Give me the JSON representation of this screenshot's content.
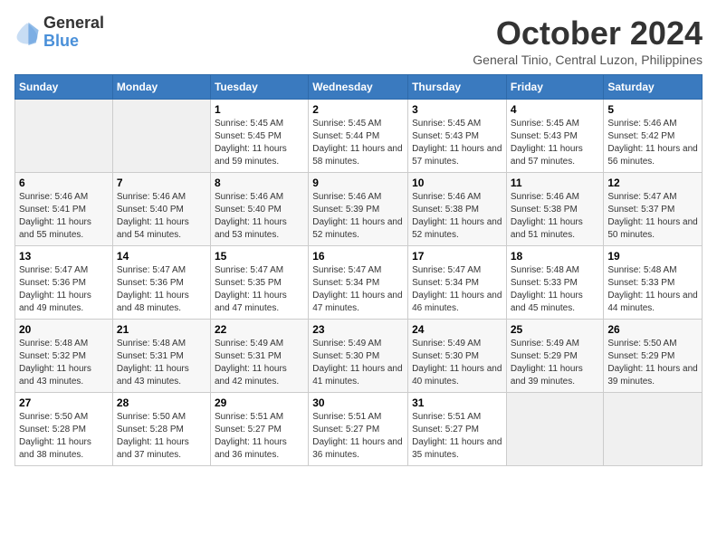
{
  "logo": {
    "general": "General",
    "blue": "Blue"
  },
  "title": "October 2024",
  "location": "General Tinio, Central Luzon, Philippines",
  "days_of_week": [
    "Sunday",
    "Monday",
    "Tuesday",
    "Wednesday",
    "Thursday",
    "Friday",
    "Saturday"
  ],
  "weeks": [
    [
      {
        "day": "",
        "content": ""
      },
      {
        "day": "",
        "content": ""
      },
      {
        "day": "1",
        "content": "Sunrise: 5:45 AM\nSunset: 5:45 PM\nDaylight: 11 hours and 59 minutes."
      },
      {
        "day": "2",
        "content": "Sunrise: 5:45 AM\nSunset: 5:44 PM\nDaylight: 11 hours and 58 minutes."
      },
      {
        "day": "3",
        "content": "Sunrise: 5:45 AM\nSunset: 5:43 PM\nDaylight: 11 hours and 57 minutes."
      },
      {
        "day": "4",
        "content": "Sunrise: 5:45 AM\nSunset: 5:43 PM\nDaylight: 11 hours and 57 minutes."
      },
      {
        "day": "5",
        "content": "Sunrise: 5:46 AM\nSunset: 5:42 PM\nDaylight: 11 hours and 56 minutes."
      }
    ],
    [
      {
        "day": "6",
        "content": "Sunrise: 5:46 AM\nSunset: 5:41 PM\nDaylight: 11 hours and 55 minutes."
      },
      {
        "day": "7",
        "content": "Sunrise: 5:46 AM\nSunset: 5:40 PM\nDaylight: 11 hours and 54 minutes."
      },
      {
        "day": "8",
        "content": "Sunrise: 5:46 AM\nSunset: 5:40 PM\nDaylight: 11 hours and 53 minutes."
      },
      {
        "day": "9",
        "content": "Sunrise: 5:46 AM\nSunset: 5:39 PM\nDaylight: 11 hours and 52 minutes."
      },
      {
        "day": "10",
        "content": "Sunrise: 5:46 AM\nSunset: 5:38 PM\nDaylight: 11 hours and 52 minutes."
      },
      {
        "day": "11",
        "content": "Sunrise: 5:46 AM\nSunset: 5:38 PM\nDaylight: 11 hours and 51 minutes."
      },
      {
        "day": "12",
        "content": "Sunrise: 5:47 AM\nSunset: 5:37 PM\nDaylight: 11 hours and 50 minutes."
      }
    ],
    [
      {
        "day": "13",
        "content": "Sunrise: 5:47 AM\nSunset: 5:36 PM\nDaylight: 11 hours and 49 minutes."
      },
      {
        "day": "14",
        "content": "Sunrise: 5:47 AM\nSunset: 5:36 PM\nDaylight: 11 hours and 48 minutes."
      },
      {
        "day": "15",
        "content": "Sunrise: 5:47 AM\nSunset: 5:35 PM\nDaylight: 11 hours and 47 minutes."
      },
      {
        "day": "16",
        "content": "Sunrise: 5:47 AM\nSunset: 5:34 PM\nDaylight: 11 hours and 47 minutes."
      },
      {
        "day": "17",
        "content": "Sunrise: 5:47 AM\nSunset: 5:34 PM\nDaylight: 11 hours and 46 minutes."
      },
      {
        "day": "18",
        "content": "Sunrise: 5:48 AM\nSunset: 5:33 PM\nDaylight: 11 hours and 45 minutes."
      },
      {
        "day": "19",
        "content": "Sunrise: 5:48 AM\nSunset: 5:33 PM\nDaylight: 11 hours and 44 minutes."
      }
    ],
    [
      {
        "day": "20",
        "content": "Sunrise: 5:48 AM\nSunset: 5:32 PM\nDaylight: 11 hours and 43 minutes."
      },
      {
        "day": "21",
        "content": "Sunrise: 5:48 AM\nSunset: 5:31 PM\nDaylight: 11 hours and 43 minutes."
      },
      {
        "day": "22",
        "content": "Sunrise: 5:49 AM\nSunset: 5:31 PM\nDaylight: 11 hours and 42 minutes."
      },
      {
        "day": "23",
        "content": "Sunrise: 5:49 AM\nSunset: 5:30 PM\nDaylight: 11 hours and 41 minutes."
      },
      {
        "day": "24",
        "content": "Sunrise: 5:49 AM\nSunset: 5:30 PM\nDaylight: 11 hours and 40 minutes."
      },
      {
        "day": "25",
        "content": "Sunrise: 5:49 AM\nSunset: 5:29 PM\nDaylight: 11 hours and 39 minutes."
      },
      {
        "day": "26",
        "content": "Sunrise: 5:50 AM\nSunset: 5:29 PM\nDaylight: 11 hours and 39 minutes."
      }
    ],
    [
      {
        "day": "27",
        "content": "Sunrise: 5:50 AM\nSunset: 5:28 PM\nDaylight: 11 hours and 38 minutes."
      },
      {
        "day": "28",
        "content": "Sunrise: 5:50 AM\nSunset: 5:28 PM\nDaylight: 11 hours and 37 minutes."
      },
      {
        "day": "29",
        "content": "Sunrise: 5:51 AM\nSunset: 5:27 PM\nDaylight: 11 hours and 36 minutes."
      },
      {
        "day": "30",
        "content": "Sunrise: 5:51 AM\nSunset: 5:27 PM\nDaylight: 11 hours and 36 minutes."
      },
      {
        "day": "31",
        "content": "Sunrise: 5:51 AM\nSunset: 5:27 PM\nDaylight: 11 hours and 35 minutes."
      },
      {
        "day": "",
        "content": ""
      },
      {
        "day": "",
        "content": ""
      }
    ]
  ]
}
